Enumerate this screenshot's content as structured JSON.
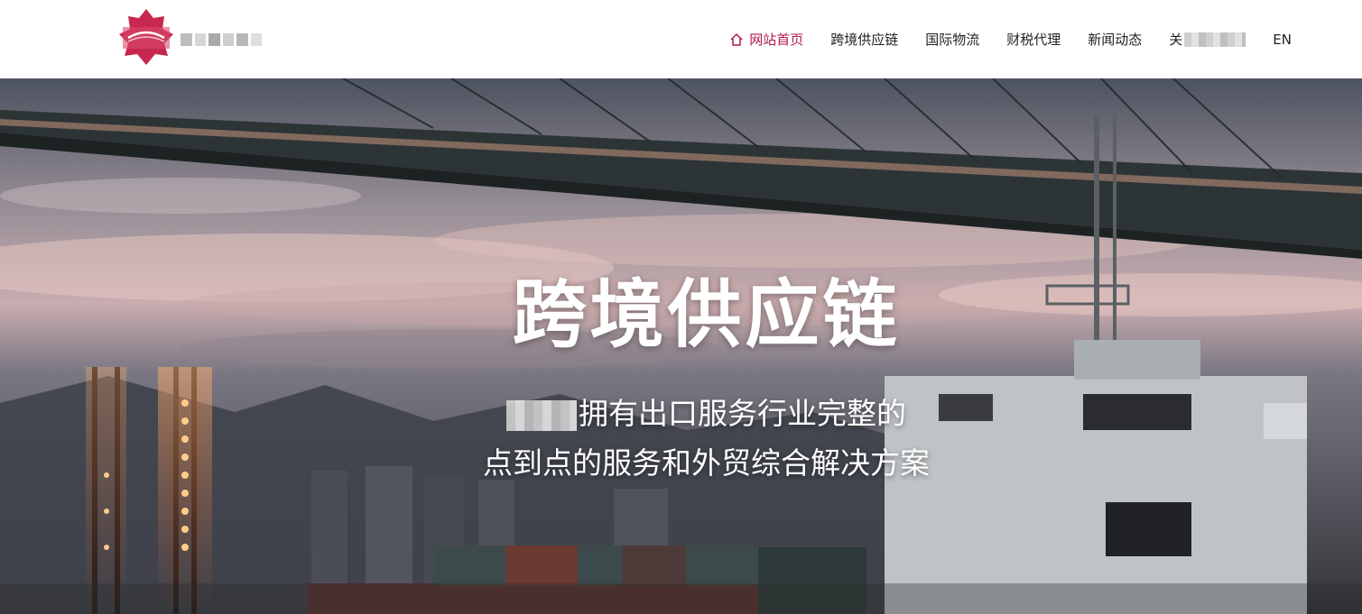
{
  "brand": {
    "logo_icon": "lotus-logo",
    "name": "",
    "accent_color": "#c8274f"
  },
  "nav": {
    "items": [
      {
        "label": "网站首页",
        "icon": "home-icon",
        "active": true
      },
      {
        "label": "跨境供应链",
        "active": false
      },
      {
        "label": "国际物流",
        "active": false
      },
      {
        "label": "财税代理",
        "active": false
      },
      {
        "label": "新闻动态",
        "active": false
      },
      {
        "label": "关",
        "active": false,
        "blurred_suffix": true
      },
      {
        "label": "EN",
        "active": false
      }
    ],
    "active_color": "#b0174f"
  },
  "hero": {
    "title": "跨境供应链",
    "subtitle_line1": "拥有出口服务行业完整的",
    "subtitle_line2": "点到点的服务和外贸综合解决方案",
    "background": "port-bridge-ship-scene"
  }
}
